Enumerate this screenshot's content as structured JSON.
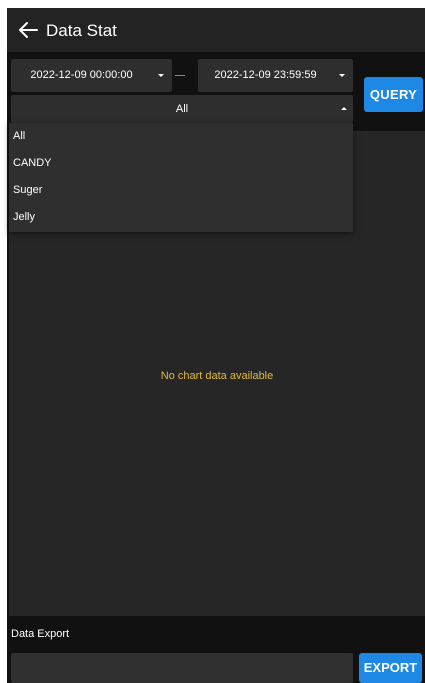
{
  "header": {
    "title": "Data Stat",
    "back_icon": "arrow-left-icon"
  },
  "filters": {
    "start_time": "2022-12-09 00:00:00",
    "end_time": "2022-12-09 23:59:59",
    "category_selected": "All",
    "query_label": "QUERY"
  },
  "dropdown": {
    "options": [
      "All",
      "CANDY",
      "Suger",
      "Jelly"
    ]
  },
  "chart": {
    "empty_message": "No chart data available"
  },
  "export": {
    "section_label": "Data Export",
    "input_value": "",
    "button_label": "EXPORT"
  },
  "colors": {
    "accent": "#1e88e5",
    "empty_text": "#e3b93a",
    "background": "#111111"
  }
}
